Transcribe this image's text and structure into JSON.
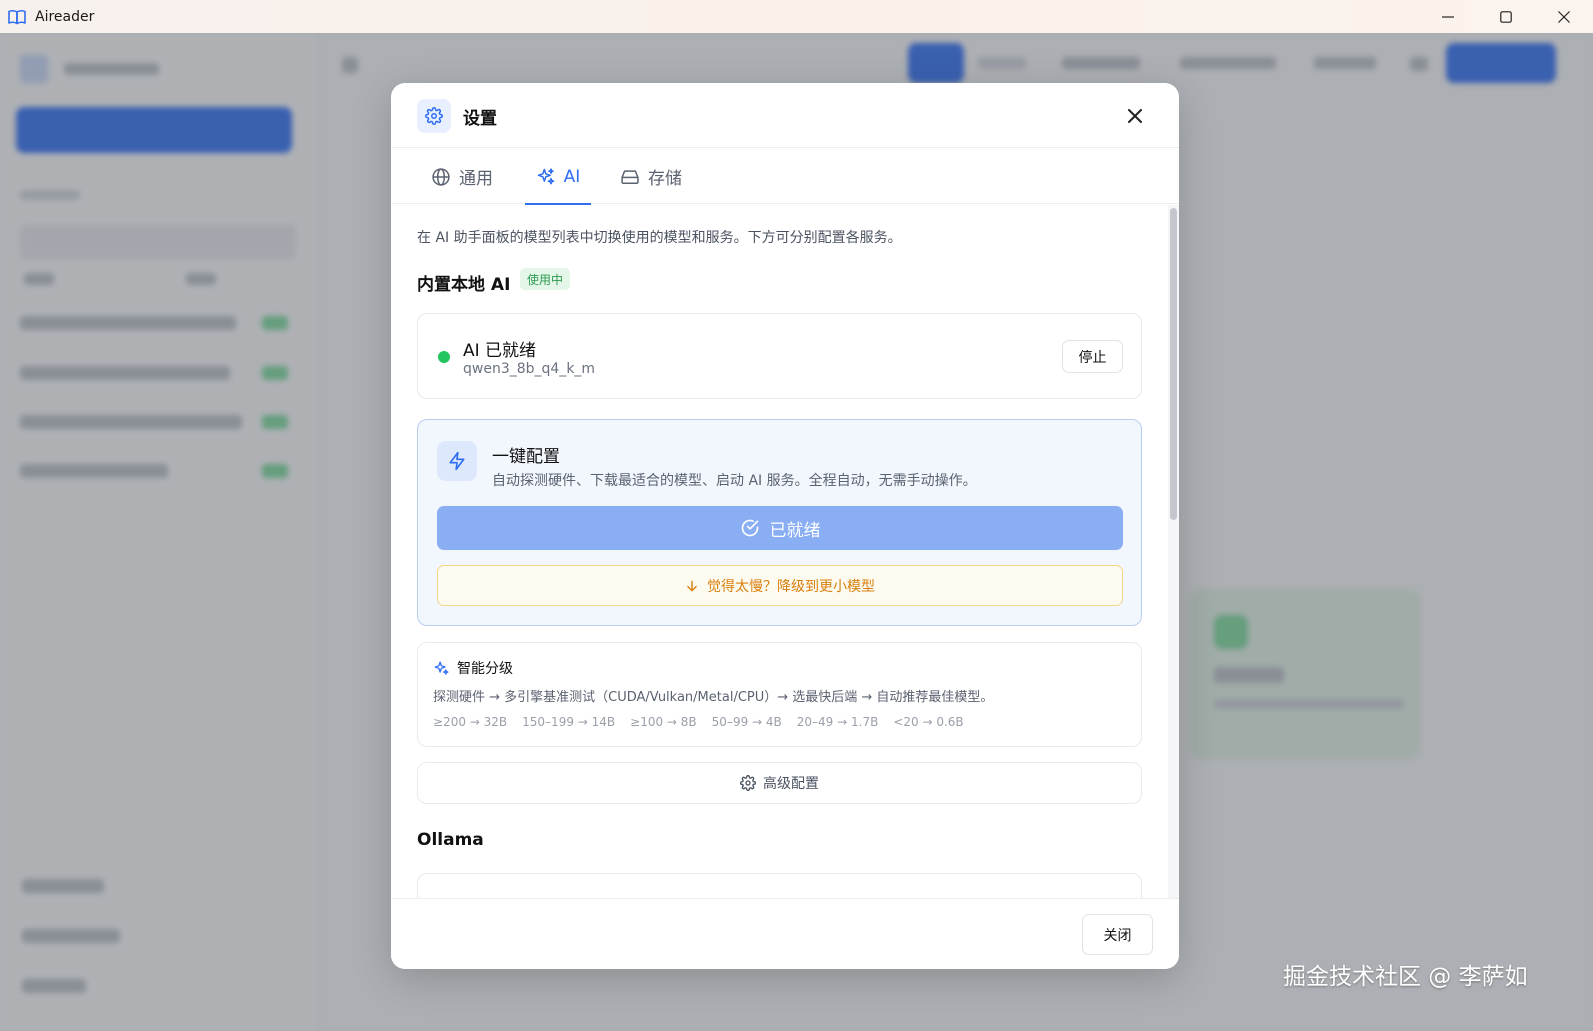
{
  "window": {
    "title": "Aireader"
  },
  "dialog": {
    "title": "设置",
    "tabs": [
      {
        "label": "通用",
        "icon": "globe-icon"
      },
      {
        "label": "AI",
        "icon": "sparkles-icon",
        "active": true
      },
      {
        "label": "存储",
        "icon": "drive-icon"
      }
    ],
    "intro": "在 AI 助手面板的模型列表中切换使用的模型和服务。下方可分别配置各服务。",
    "builtin": {
      "title": "内置本地 AI",
      "badge": "使用中",
      "status_title": "AI 已就绪",
      "model": "qwen3_8b_q4_k_m",
      "stop_label": "停止"
    },
    "quick": {
      "title": "一键配置",
      "desc": "自动探测硬件、下载最适合的模型、启动 AI 服务。全程自动，无需手动操作。",
      "ready_label": "已就绪",
      "downgrade_label": "觉得太慢？降级到更小模型"
    },
    "tiering": {
      "title": "智能分级",
      "desc": "探测硬件 → 多引擎基准测试（CUDA/Vulkan/Metal/CPU）→ 选最快后端 → 自动推荐最佳模型。",
      "tiers": [
        "≥200 → 32B",
        "150–199 → 14B",
        "≥100 → 8B",
        "50–99 → 4B",
        "20–49 → 1.7B",
        "<20 → 0.6B"
      ]
    },
    "advanced_label": "高级配置",
    "ollama_title": "Ollama",
    "close_label": "关闭"
  },
  "watermark": "掘金技术社区 @ 李萨如",
  "colors": {
    "accent": "#2f6df2",
    "success": "#22c55e",
    "warning": "#d9800e"
  }
}
